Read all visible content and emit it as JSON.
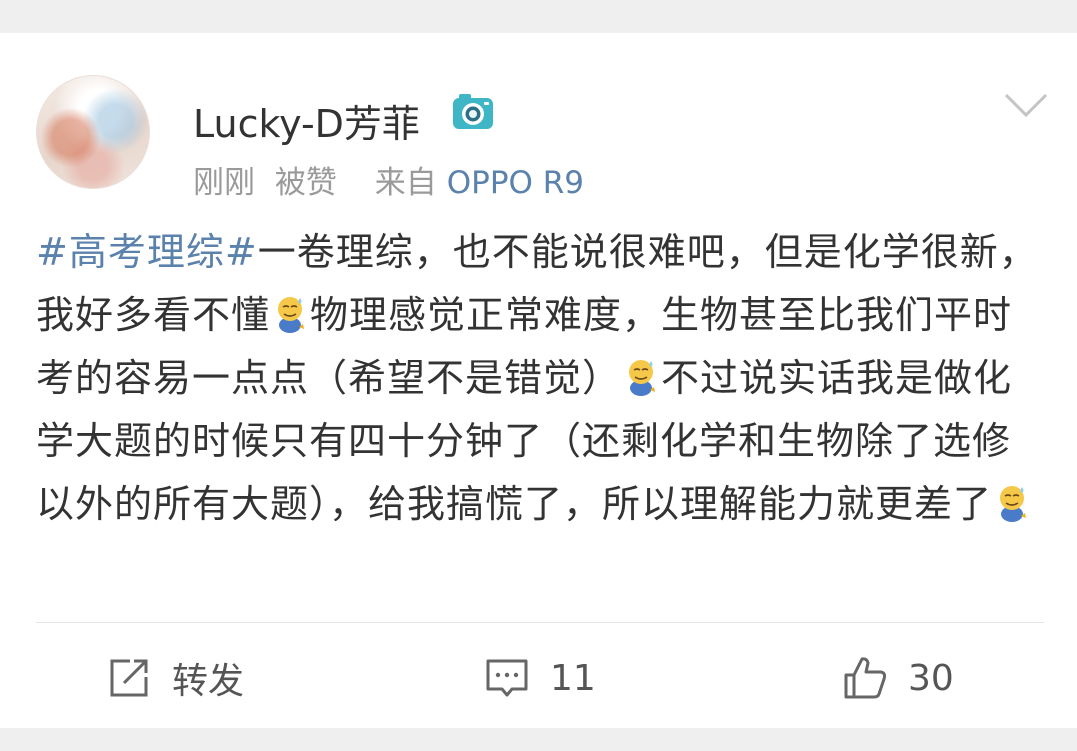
{
  "post": {
    "username": "Lucky-D芳菲",
    "meta": {
      "time": "刚刚",
      "liked": "被赞",
      "source_prefix": "来自",
      "device": "OPPO R9"
    },
    "topic": "#高考理综#",
    "segments": [
      "一卷理综，也不能说很难吧，但是化学很新，我好多看不懂",
      "物理感觉正常难度，生物甚至比我们平时考的容易一点点（希望不是错觉）",
      "不过说实话我是做化学大题的时候只有四十分钟了（还剩化学和生物除了选修以外的所有大题），给我搞慌了，所以理解能力就更差了"
    ],
    "emoji_name": "sweat-smile-emoji"
  },
  "actions": {
    "repost_label": "转发",
    "comment_count": "11",
    "like_count": "30"
  },
  "colors": {
    "link": "#5b82ac",
    "text": "#333333",
    "muted": "#9a9a9a",
    "background": "#efefef"
  },
  "icons": [
    "camera-icon",
    "chevron-down-icon",
    "repost-icon",
    "comment-icon",
    "thumbs-up-icon"
  ]
}
